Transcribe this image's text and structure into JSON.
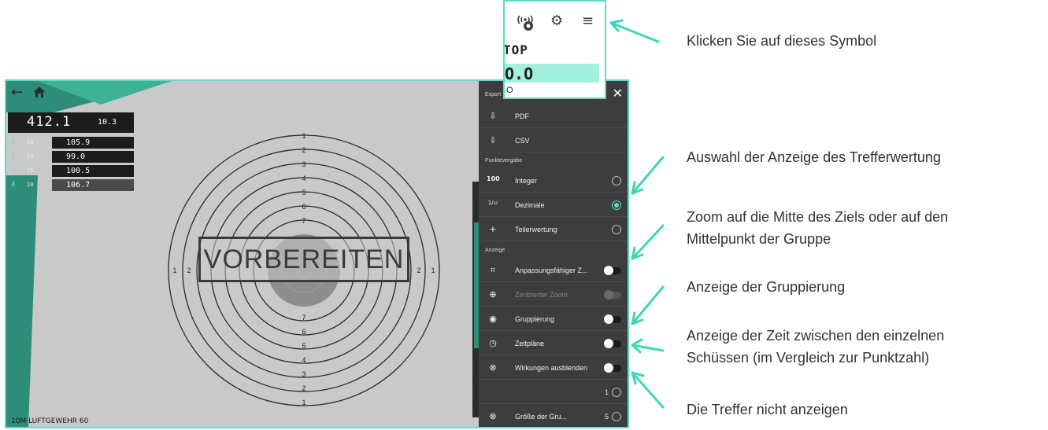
{
  "app": {
    "total_score": "412.1",
    "last_shot": "10.3",
    "series": [
      {
        "num": "1",
        "shots": "10",
        "score": "105.9"
      },
      {
        "num": "2",
        "shots": "10",
        "score": "99.0"
      },
      {
        "num": "3",
        "shots": "10",
        "score": "100.5"
      },
      {
        "num": "4",
        "shots": "10",
        "score": "106.7"
      }
    ],
    "overlay_text": "VORBEREITEN",
    "discipline_label": "10M LUFTGEWEHR 60",
    "ring_labels_top": [
      "1",
      "2",
      "3",
      "4",
      "5",
      "6",
      "7"
    ],
    "ring_labels_bottom": [
      "7",
      "6",
      "5",
      "4",
      "3",
      "2",
      "1"
    ],
    "ring_labels_left": [
      "1",
      "2"
    ],
    "ring_labels_right": [
      "2",
      "1"
    ]
  },
  "drawer": {
    "export_header": "Export",
    "export_items": [
      "PDF",
      "CSV"
    ],
    "points_header": "Punktevergabe",
    "points_items": [
      {
        "icon_text": "100",
        "label": "Integer",
        "selected": false
      },
      {
        "icon_text": "1/₁₀",
        "label": "Dezimale",
        "selected": true
      },
      {
        "icon_text": "+",
        "label": "Teilerwertung",
        "selected": false
      }
    ],
    "display_header": "Anzeige",
    "display_items": [
      {
        "icon": "crop-icon",
        "label": "Anpassungsfähiger Z...",
        "on": true,
        "disabled": false
      },
      {
        "icon": "crosshair-icon",
        "label": "Zentrierter Zoom",
        "on": false,
        "disabled": true
      },
      {
        "icon": "eye-icon",
        "label": "Gruppierung",
        "on": true,
        "disabled": false
      },
      {
        "icon": "clock-icon",
        "label": "Zeitpläne",
        "on": true,
        "disabled": false
      },
      {
        "icon": "cancel-circle-icon",
        "label": "Wirkungen ausblenden",
        "on": true,
        "disabled": false
      }
    ],
    "stepper_value_1": "1",
    "group_size_label": "Größe der Gru...",
    "group_size_value": "5"
  },
  "callout": {
    "status": "TOP",
    "score": "O.O",
    "small": "O",
    "icons": [
      "signal-icon",
      "gear-icon",
      "menu-icon"
    ]
  },
  "notes": {
    "click_icon": "Klicken Sie auf dieses Symbol",
    "score_display": "Auswahl der Anzeige des Trefferwertung",
    "zoom_line1": "Zoom auf die Mitte des Ziels oder auf den",
    "zoom_line2": "Mittelpunkt der Gruppe",
    "grouping": "Anzeige der Gruppierung",
    "time_line1": "Anzeige der Zeit zwischen den einzelnen",
    "time_line2": "Schüssen (im Vergleich zur Punktzahl)",
    "hide_hits": "Die Treffer nicht anzeigen"
  },
  "colors": {
    "accent": "#5fdcc1",
    "drawer_bg": "#3d3d3d",
    "target_bg": "#c9c9c9"
  }
}
